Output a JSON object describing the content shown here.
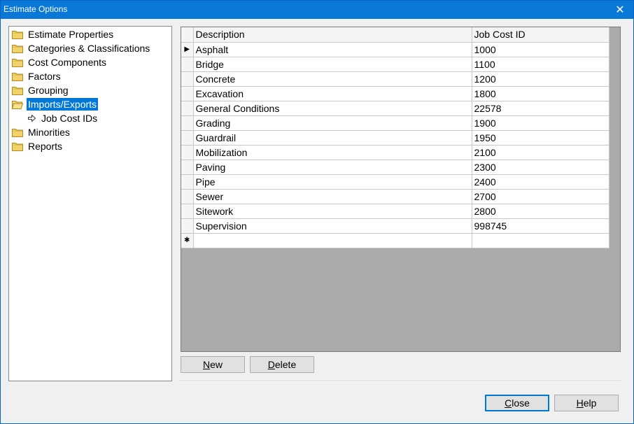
{
  "window": {
    "title": "Estimate Options",
    "close_glyph": "✕"
  },
  "tree": {
    "items": [
      {
        "label": "Estimate Properties",
        "icon": "folder-icon"
      },
      {
        "label": "Categories & Classifications",
        "icon": "folder-icon"
      },
      {
        "label": "Cost Components",
        "icon": "folder-icon"
      },
      {
        "label": "Factors",
        "icon": "folder-icon"
      },
      {
        "label": "Grouping",
        "icon": "folder-icon"
      },
      {
        "label": "Imports/Exports",
        "icon": "folder-open-icon",
        "selected": true
      },
      {
        "label": "Job Cost IDs",
        "icon": "arrow-icon",
        "child": true
      },
      {
        "label": "Minorities",
        "icon": "folder-icon"
      },
      {
        "label": "Reports",
        "icon": "folder-icon"
      }
    ]
  },
  "grid": {
    "headers": {
      "description": "Description",
      "job_cost_id": "Job Cost ID"
    },
    "current_row_marker": "▶",
    "new_row_marker": "✱",
    "rows": [
      {
        "description": "Asphalt",
        "id": "1000"
      },
      {
        "description": "Bridge",
        "id": "1100"
      },
      {
        "description": "Concrete",
        "id": "1200"
      },
      {
        "description": "Excavation",
        "id": "1800"
      },
      {
        "description": "General Conditions",
        "id": "22578"
      },
      {
        "description": "Grading",
        "id": "1900"
      },
      {
        "description": "Guardrail",
        "id": "1950"
      },
      {
        "description": "Mobilization",
        "id": "2100"
      },
      {
        "description": "Paving",
        "id": "2300"
      },
      {
        "description": "Pipe",
        "id": "2400"
      },
      {
        "description": "Sewer",
        "id": "2700"
      },
      {
        "description": "Sitework",
        "id": "2800"
      },
      {
        "description": "Supervision",
        "id": "998745"
      }
    ]
  },
  "buttons": {
    "new": {
      "mnemonic": "N",
      "rest": "ew"
    },
    "delete": {
      "mnemonic": "D",
      "rest": "elete"
    },
    "close": {
      "mnemonic": "C",
      "rest": "lose"
    },
    "help": {
      "mnemonic": "H",
      "rest": "elp"
    }
  }
}
